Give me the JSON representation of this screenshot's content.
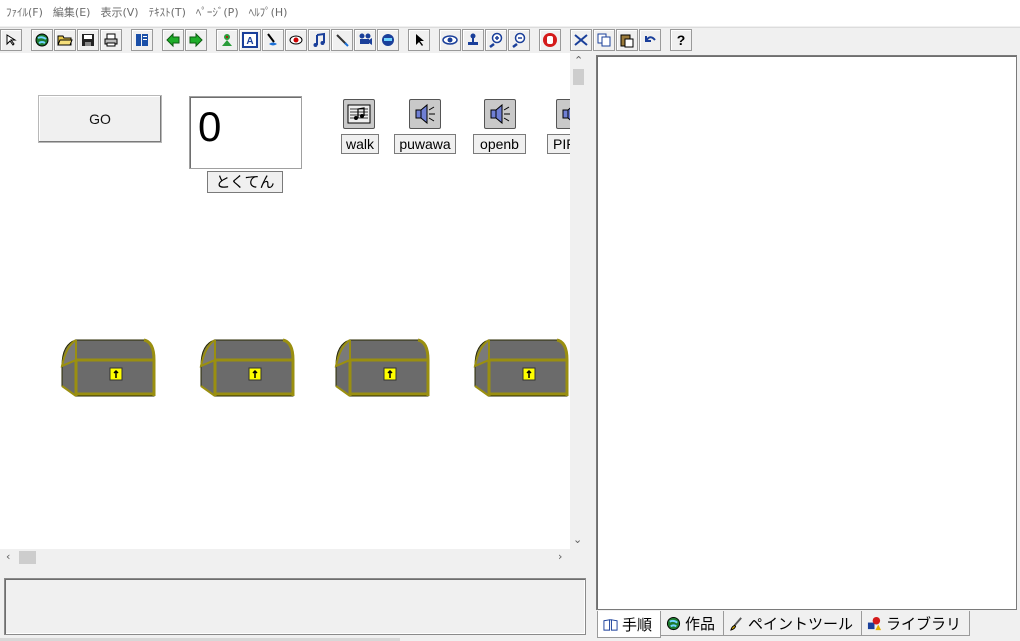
{
  "menu": {
    "items": [
      "ﾌｧｲﾙ(F)",
      "編集(E)",
      "表示(V)",
      "ﾃｷｽﾄ(T)",
      "ﾍﾟｰｼﾞ(P)",
      "ﾍﾙﾌﾟ(H)"
    ]
  },
  "toolbar": {
    "icons": [
      "select-arrow-icon",
      "globe-icon",
      "open-folder-icon",
      "save-disk-icon",
      "print-icon",
      "book-icon",
      "back-arrow-icon",
      "forward-arrow-icon",
      "character-icon",
      "text-A-icon",
      "paint-icon",
      "eye-button-icon",
      "music-note-icon",
      "pen-icon",
      "movie-camera-icon",
      "robot-icon",
      "pointer-icon",
      "view-eye-icon",
      "stamp-icon",
      "zoom-in-icon",
      "zoom-out-icon",
      "stop-hand-icon",
      "cut-icon",
      "copy-icon",
      "paste-icon",
      "undo-icon",
      "help-icon"
    ],
    "help_label": "?"
  },
  "stage": {
    "go_label": "GO",
    "score_value": "0",
    "score_label": "とくてん",
    "sounds": [
      {
        "label": "walk",
        "icon": "music-score-icon"
      },
      {
        "label": "puwawa",
        "icon": "speaker-icon"
      },
      {
        "label": "openb",
        "icon": "speaker-icon"
      },
      {
        "label": "PIP",
        "icon": "speaker-icon"
      }
    ],
    "chest_count": 4
  },
  "tabs": [
    {
      "label": "手順",
      "icon": "book-icon",
      "active": true
    },
    {
      "label": "作品",
      "icon": "globe-icon",
      "active": false
    },
    {
      "label": "ペイントツール",
      "icon": "paintbrush-icon",
      "active": false
    },
    {
      "label": "ライブラリ",
      "icon": "library-shapes-icon",
      "active": false
    }
  ],
  "colors": {
    "chest_body": "#6b6b6b",
    "chest_trim": "#9a8f10",
    "chest_lock": "#ffff00"
  }
}
